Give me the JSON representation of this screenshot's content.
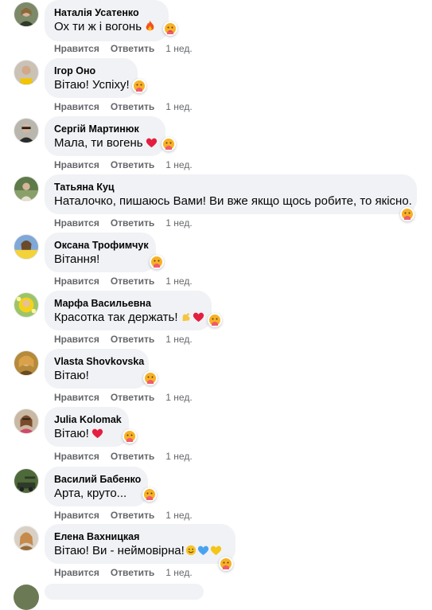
{
  "actions": {
    "like": "Нравится",
    "reply": "Ответить"
  },
  "reaction_icon": "care-reaction-icon",
  "colors": {
    "bubble": "#f0f2f5",
    "meta": "#65676b",
    "text": "#050505",
    "heart": "#e41e3f"
  },
  "comments": [
    {
      "name": "Наталія Усатенко",
      "text": "Ох ти ж і вогонь",
      "emoji": [
        "fire-emoji"
      ],
      "time": "1 нед."
    },
    {
      "name": "Ігор Оно",
      "text": "Вітаю! Успіху!",
      "emoji": [],
      "time": "1 нед."
    },
    {
      "name": "Сергій Мартинюк",
      "text": "Мала, ти вогень",
      "emoji": [
        "heart-emoji"
      ],
      "time": "1 нед."
    },
    {
      "name": "Татьяна Куц",
      "text": "Наталочко, пишаюсь Вами! Ви вже якщо щось робите, то якісно.",
      "emoji": [],
      "time": "1 нед."
    },
    {
      "name": "Оксана Трофимчук",
      "text": "Вітання!",
      "emoji": [],
      "time": "1 нед."
    },
    {
      "name": "Марфа Васильевна",
      "text": "Красотка так держать!",
      "emoji": [
        "flexed-biceps-emoji",
        "heart-emoji"
      ],
      "time": "1 нед."
    },
    {
      "name": "Vlasta Shovkovska",
      "text": "Вітаю!",
      "emoji": [],
      "time": "1 нед."
    },
    {
      "name": "Julia Kolomak",
      "text": "Вітаю!",
      "emoji": [
        "heart-emoji"
      ],
      "time": "1 нед."
    },
    {
      "name": "Василий Бабенко",
      "text": "Арта, круто...",
      "emoji": [],
      "time": "1 нед."
    },
    {
      "name": "Елена Вахницкая",
      "text": "Вітаю! Ви - неймовірна!",
      "emoji": [
        "smile-emoji",
        "blue-heart-emoji",
        "yellow-heart-emoji"
      ],
      "time": "1 нед."
    }
  ]
}
